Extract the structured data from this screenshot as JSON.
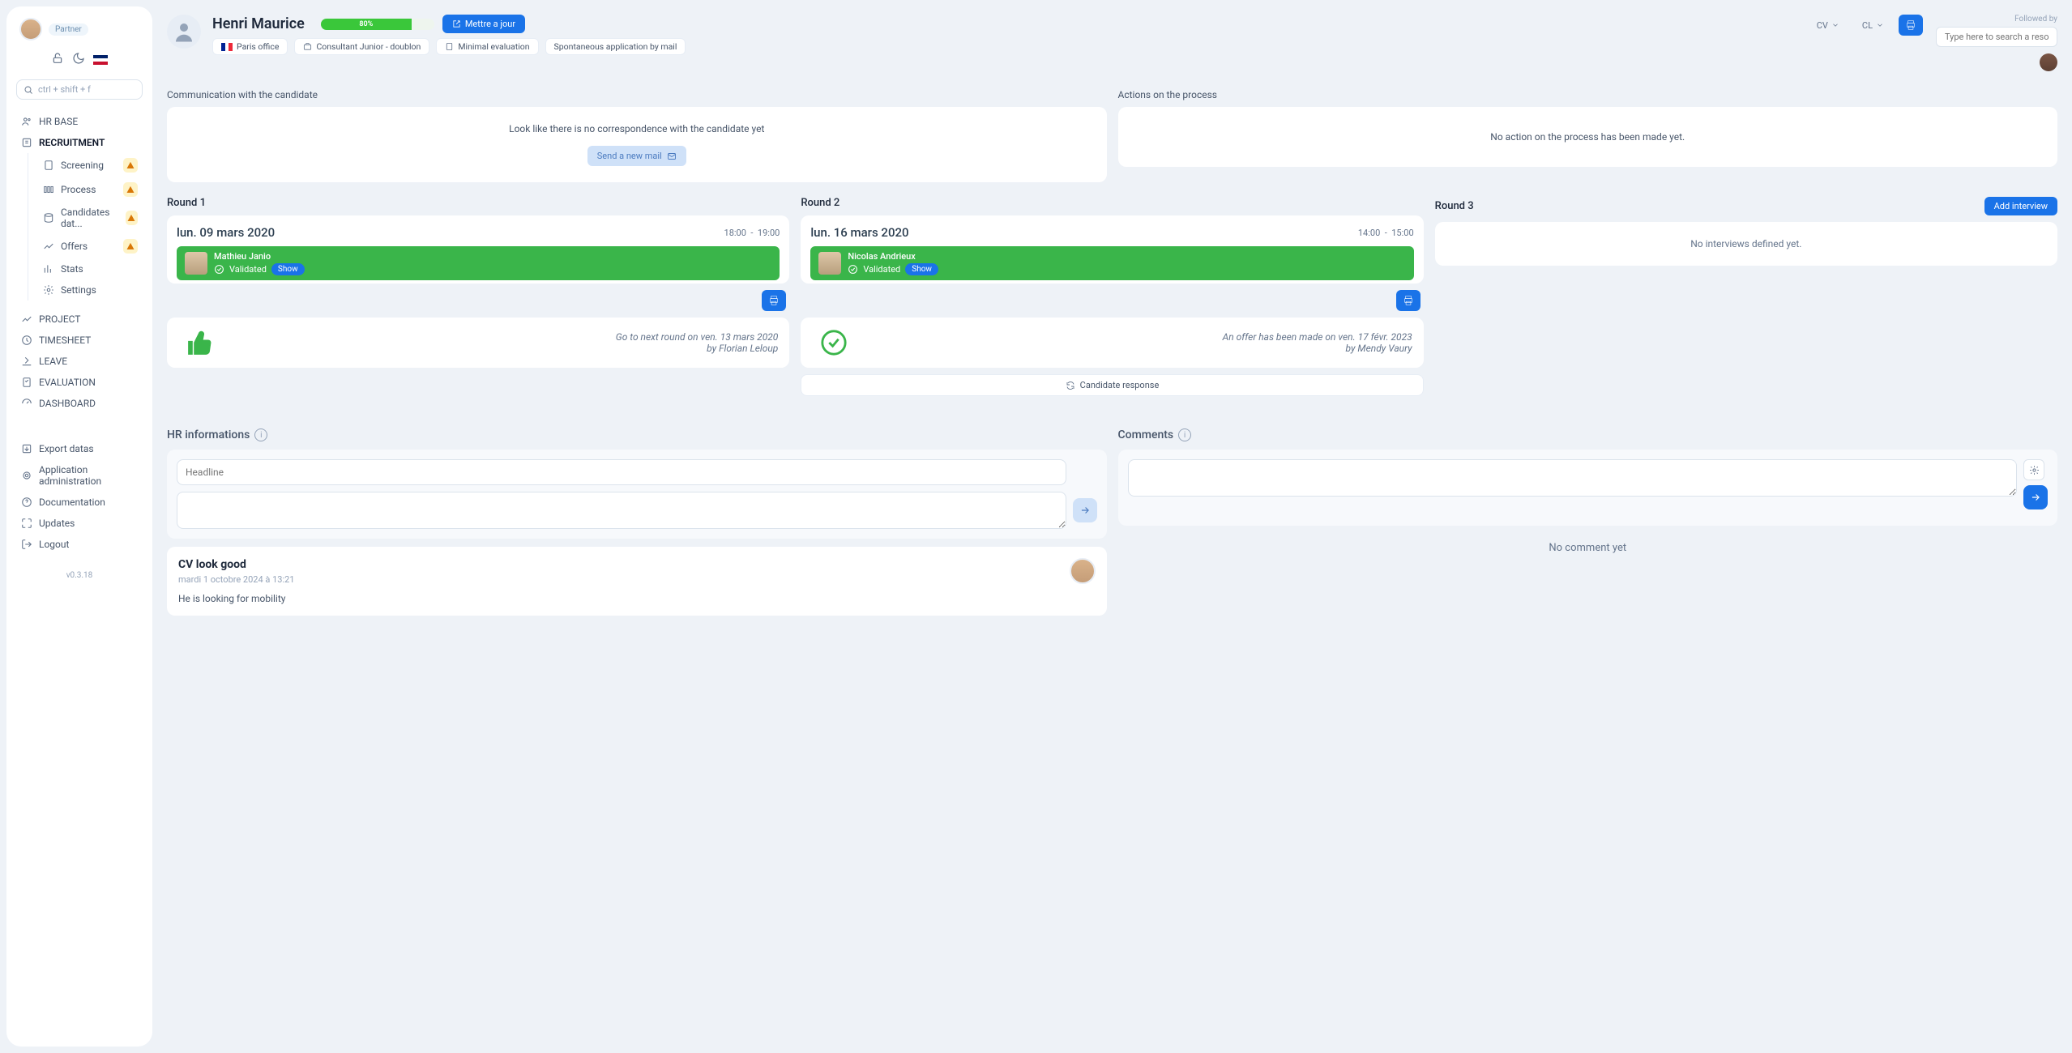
{
  "user": {
    "role_badge": "Partner"
  },
  "search_shortcut": "ctrl + shift + f",
  "nav": {
    "hr_base": "HR BASE",
    "recruitment": "RECRUITMENT",
    "sub": {
      "screening": "Screening",
      "process": "Process",
      "candidates_db": "Candidates dat...",
      "offers": "Offers",
      "stats": "Stats",
      "settings": "Settings"
    },
    "project": "PROJECT",
    "timesheet": "TIMESHEET",
    "leave": "LEAVE",
    "evaluation": "EVALUATION",
    "dashboard": "DASHBOARD",
    "export": "Export datas",
    "admin": "Application administration",
    "docs": "Documentation",
    "updates": "Updates",
    "logout": "Logout"
  },
  "version": "v0.3.18",
  "candidate": {
    "name": "Henri Maurice",
    "progress_pct": "80%",
    "update_btn": "Mettre a jour",
    "tags": {
      "office": "Paris office",
      "position": "Consultant Junior - doublon",
      "evaluation": "Minimal evaluation",
      "source": "Spontaneous application by mail"
    }
  },
  "header_actions": {
    "cv": "CV",
    "cl": "CL"
  },
  "followed": {
    "label": "Followed by",
    "search_placeholder": "Type here to search a resource"
  },
  "communication": {
    "title": "Communication with the candidate",
    "empty": "Look like there is no correspondence with the candidate yet",
    "send_btn": "Send a new mail"
  },
  "actions_process": {
    "title": "Actions on the process",
    "empty": "No action on the process has been made yet."
  },
  "rounds": {
    "add_interview_btn": "Add interview",
    "r1": {
      "title": "Round 1",
      "date": "lun. 09 mars 2020",
      "time_start": "18:00",
      "time_sep": "-",
      "time_end": "19:00",
      "interviewer": "Mathieu Janio",
      "validated": "Validated",
      "show": "Show",
      "status": "Go to next round on ven. 13 mars 2020",
      "by": "by Florian Leloup"
    },
    "r2": {
      "title": "Round 2",
      "date": "lun. 16 mars 2020",
      "time_start": "14:00",
      "time_sep": "-",
      "time_end": "15:00",
      "interviewer": "Nicolas Andrieux",
      "validated": "Validated",
      "show": "Show",
      "status": "An offer has been made on ven. 17 févr. 2023",
      "by": "by Mendy Vaury",
      "candidate_response": "Candidate response"
    },
    "r3": {
      "title": "Round 3",
      "empty": "No interviews defined yet."
    }
  },
  "hr_info": {
    "title": "HR informations",
    "headline_placeholder": "Headline",
    "note": {
      "title": "CV look good",
      "date": "mardi 1 octobre 2024 à 13:21",
      "body": "He is looking for mobility"
    }
  },
  "comments": {
    "title": "Comments",
    "empty": "No comment yet"
  }
}
